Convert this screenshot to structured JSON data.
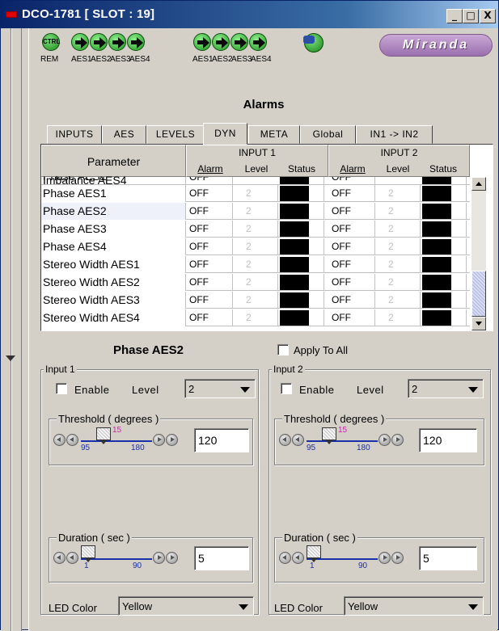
{
  "window": {
    "title": "DCO-1781 [ SLOT : 19]"
  },
  "titlebar_buttons": [
    "_",
    "□",
    "X"
  ],
  "header": {
    "ctrl_label": "CTRL",
    "rem_label": "REM",
    "input_group1_labels": [
      "AES1",
      "AES2",
      "AES3",
      "AES4"
    ],
    "input_group2_labels": [
      "AES1",
      "AES2",
      "AES3",
      "AES4"
    ],
    "logo": "Miranda"
  },
  "page_title": "Alarms",
  "tabs": [
    {
      "label": "INPUTS"
    },
    {
      "label": "AES"
    },
    {
      "label": "LEVELS"
    },
    {
      "label": "DYN",
      "active": true
    },
    {
      "label": "META"
    },
    {
      "label": "Global"
    },
    {
      "label": "IN1 -> IN2"
    }
  ],
  "table": {
    "param_header": "Parameter",
    "input1_header": "INPUT 1",
    "input2_header": "INPUT 2",
    "sub_headers": [
      "Alarm",
      "Level",
      "Status"
    ],
    "partial_row_text": "Imbalance AES4",
    "rows": [
      {
        "param": "Phase AES1",
        "a1": "OFF",
        "l1": "2",
        "a2": "OFF",
        "l2": "2"
      },
      {
        "param": "Phase AES2",
        "a1": "OFF",
        "l1": "2",
        "a2": "OFF",
        "l2": "2",
        "selected": true
      },
      {
        "param": "Phase AES3",
        "a1": "OFF",
        "l1": "2",
        "a2": "OFF",
        "l2": "2"
      },
      {
        "param": "Phase AES4",
        "a1": "OFF",
        "l1": "2",
        "a2": "OFF",
        "l2": "2"
      },
      {
        "param": "Stereo Width AES1",
        "a1": "OFF",
        "l1": "2",
        "a2": "OFF",
        "l2": "2"
      },
      {
        "param": "Stereo Width AES2",
        "a1": "OFF",
        "l1": "2",
        "a2": "OFF",
        "l2": "2"
      },
      {
        "param": "Stereo Width AES3",
        "a1": "OFF",
        "l1": "2",
        "a2": "OFF",
        "l2": "2"
      },
      {
        "param": "Stereo Width AES4",
        "a1": "OFF",
        "l1": "2",
        "a2": "OFF",
        "l2": "2"
      }
    ]
  },
  "selected_param": "Phase AES2",
  "apply_to_all": "Apply To All",
  "input1": {
    "group_label": "Input 1",
    "enable_label": "Enable",
    "level_label": "Level",
    "level_value": "2",
    "threshold": {
      "label": "Threshold ( degrees )",
      "min": "95",
      "max": "180",
      "marker": "15",
      "value": "120"
    },
    "duration": {
      "label": "Duration ( sec )",
      "min": "1",
      "max": "90",
      "value": "5"
    },
    "led_label": "LED Color",
    "led_value": "Yellow"
  },
  "input2": {
    "group_label": "Input 2",
    "enable_label": "Enable",
    "level_label": "Level",
    "level_value": "2",
    "threshold": {
      "label": "Threshold ( degrees )",
      "min": "95",
      "max": "180",
      "marker": "15",
      "value": "120"
    },
    "duration": {
      "label": "Duration ( sec )",
      "min": "1",
      "max": "90",
      "value": "5"
    },
    "led_label": "LED Color",
    "led_value": "Yellow"
  },
  "colors": {
    "titlebar": "#0a246a",
    "status_off": "#000000",
    "slider_track": "#1a30a8",
    "marker": "#d01fb0"
  }
}
